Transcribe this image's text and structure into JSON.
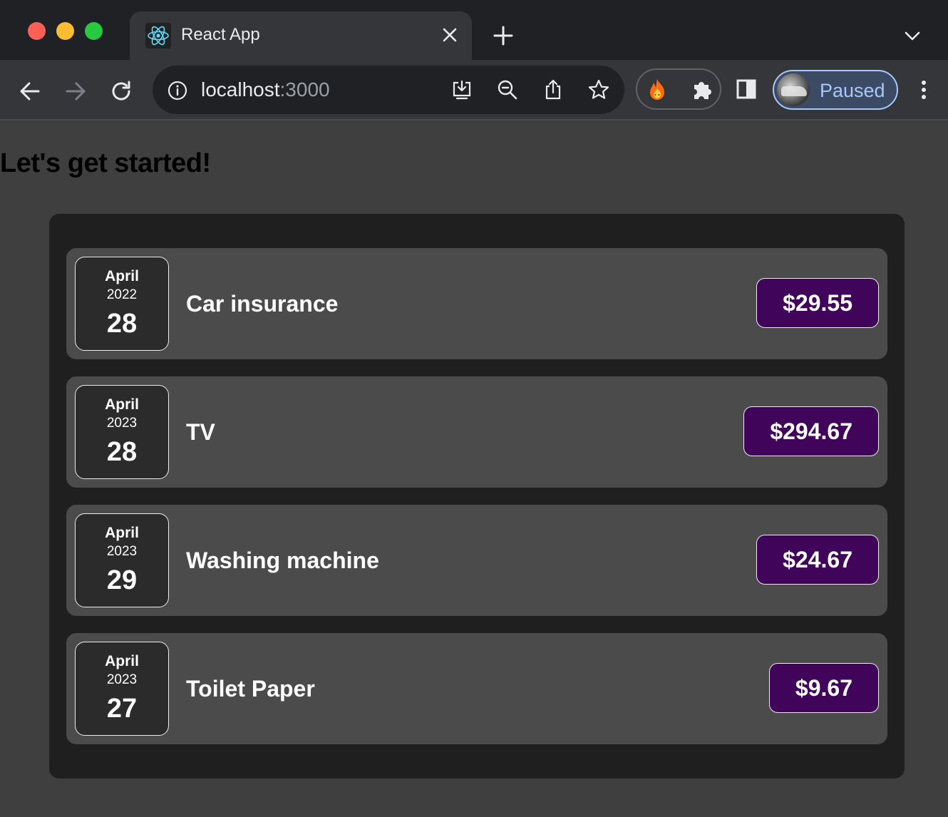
{
  "browser": {
    "tab": {
      "title": "React App",
      "favicon": "react-logo-icon"
    },
    "url": {
      "host": "localhost",
      "port": ":3000"
    },
    "profile": {
      "label": "Paused"
    },
    "colors": {
      "profile_accent": "#a8c7fa",
      "tab_bg": "#35363a",
      "frame_bg": "#202124"
    }
  },
  "page": {
    "heading": "Let's get started!",
    "colors": {
      "background": "#3f3f3f",
      "card": "#1f1f1f",
      "item": "#4b4b4b",
      "price": "#40045a"
    }
  },
  "expenses": [
    {
      "month": "April",
      "year": "2022",
      "day": "28",
      "title": "Car insurance",
      "amount": "$29.55"
    },
    {
      "month": "April",
      "year": "2023",
      "day": "28",
      "title": "TV",
      "amount": "$294.67"
    },
    {
      "month": "April",
      "year": "2023",
      "day": "29",
      "title": "Washing machine",
      "amount": "$24.67"
    },
    {
      "month": "April",
      "year": "2023",
      "day": "27",
      "title": "Toilet Paper",
      "amount": "$9.67"
    }
  ]
}
